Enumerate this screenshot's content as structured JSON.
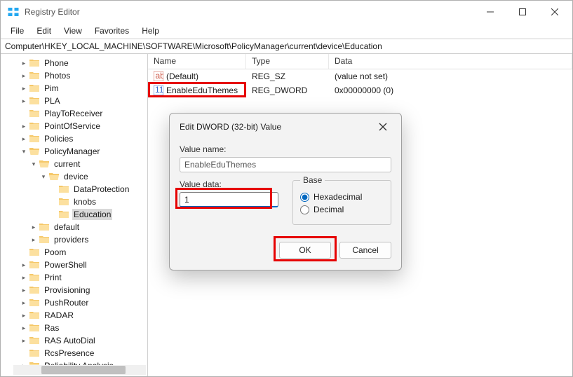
{
  "window": {
    "title": "Registry Editor"
  },
  "menu": {
    "file": "File",
    "edit": "Edit",
    "view": "View",
    "favorites": "Favorites",
    "help": "Help"
  },
  "path": "Computer\\HKEY_LOCAL_MACHINE\\SOFTWARE\\Microsoft\\PolicyManager\\current\\device\\Education",
  "tree": [
    {
      "label": "Phone",
      "indent": 24,
      "arrow": ">"
    },
    {
      "label": "Photos",
      "indent": 24,
      "arrow": ">"
    },
    {
      "label": "Pim",
      "indent": 24,
      "arrow": ">"
    },
    {
      "label": "PLA",
      "indent": 24,
      "arrow": ">"
    },
    {
      "label": "PlayToReceiver",
      "indent": 24,
      "arrow": ""
    },
    {
      "label": "PointOfService",
      "indent": 24,
      "arrow": ">"
    },
    {
      "label": "Policies",
      "indent": 24,
      "arrow": ">"
    },
    {
      "label": "PolicyManager",
      "indent": 24,
      "arrow": "v",
      "open": true
    },
    {
      "label": "current",
      "indent": 38,
      "arrow": "v",
      "open": true
    },
    {
      "label": "device",
      "indent": 52,
      "arrow": "v",
      "open": true
    },
    {
      "label": "DataProtection",
      "indent": 66,
      "arrow": ""
    },
    {
      "label": "knobs",
      "indent": 66,
      "arrow": ""
    },
    {
      "label": "Education",
      "indent": 66,
      "arrow": "",
      "selected": true
    },
    {
      "label": "default",
      "indent": 38,
      "arrow": ">"
    },
    {
      "label": "providers",
      "indent": 38,
      "arrow": ">"
    },
    {
      "label": "Poom",
      "indent": 24,
      "arrow": ""
    },
    {
      "label": "PowerShell",
      "indent": 24,
      "arrow": ">"
    },
    {
      "label": "Print",
      "indent": 24,
      "arrow": ">"
    },
    {
      "label": "Provisioning",
      "indent": 24,
      "arrow": ">"
    },
    {
      "label": "PushRouter",
      "indent": 24,
      "arrow": ">"
    },
    {
      "label": "RADAR",
      "indent": 24,
      "arrow": ">"
    },
    {
      "label": "Ras",
      "indent": 24,
      "arrow": ">"
    },
    {
      "label": "RAS AutoDial",
      "indent": 24,
      "arrow": ">"
    },
    {
      "label": "RcsPresence",
      "indent": 24,
      "arrow": ""
    },
    {
      "label": "Reliability Analysis",
      "indent": 24,
      "arrow": ">"
    }
  ],
  "list": {
    "headers": {
      "name": "Name",
      "type": "Type",
      "data": "Data"
    },
    "rows": [
      {
        "name": "(Default)",
        "type": "REG_SZ",
        "data": "(value not set)",
        "icon": "sz"
      },
      {
        "name": "EnableEduThemes",
        "type": "REG_DWORD",
        "data": "0x00000000 (0)",
        "icon": "dw",
        "highlight": true
      }
    ]
  },
  "dialog": {
    "title": "Edit DWORD (32-bit) Value",
    "value_name_label": "Value name:",
    "value_name": "EnableEduThemes",
    "value_data_label": "Value data:",
    "value_data": "1",
    "base_label": "Base",
    "hex_label": "Hexadecimal",
    "dec_label": "Decimal",
    "ok": "OK",
    "cancel": "Cancel"
  }
}
